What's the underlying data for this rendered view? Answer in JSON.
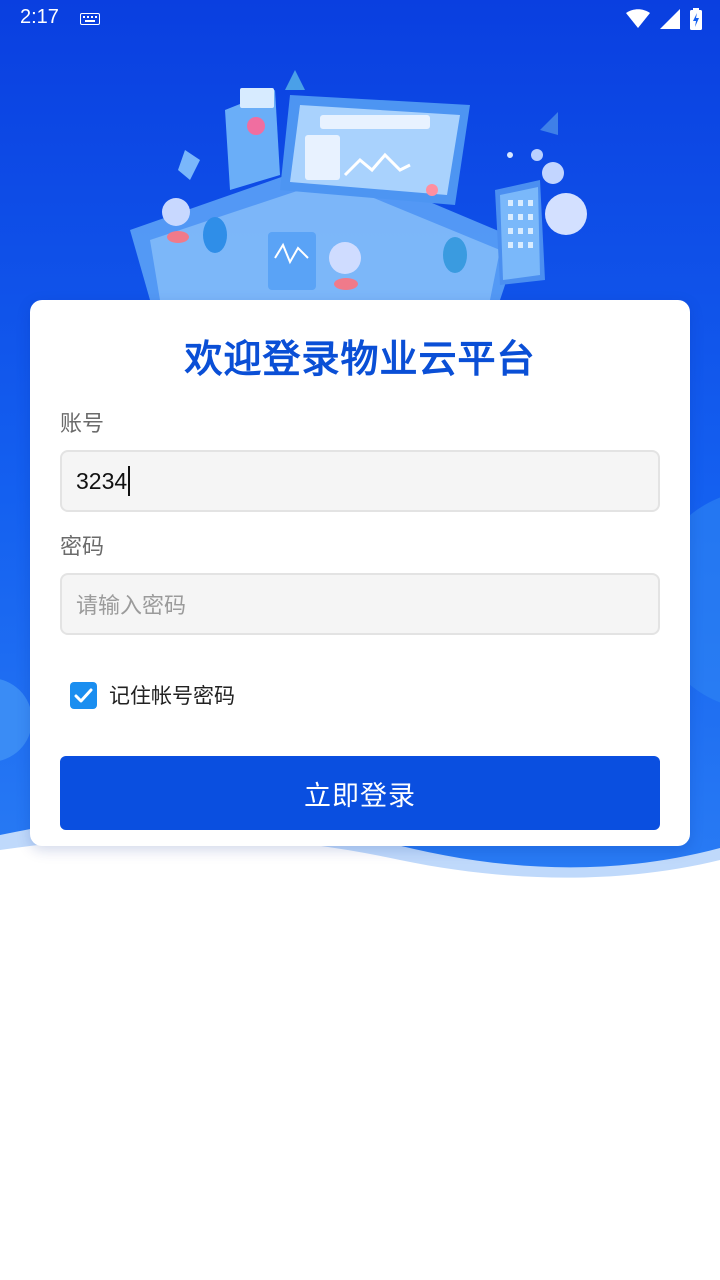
{
  "status_bar": {
    "time": "2:17",
    "keyboard_icon": "keyboard-icon",
    "wifi_icon": "wifi-icon",
    "signal_icon": "signal-icon",
    "battery_icon": "battery-charging-icon"
  },
  "login": {
    "title": "欢迎登录物业云平台",
    "account_label": "账号",
    "account_value": "3234",
    "password_label": "密码",
    "password_placeholder": "请输入密码",
    "remember_label": "记住帐号密码",
    "remember_checked": true,
    "submit_label": "立即登录"
  },
  "colors": {
    "brand_blue": "#0a4fe0",
    "title_blue": "#0a4fd6",
    "checkbox_blue": "#1a8ef0"
  }
}
